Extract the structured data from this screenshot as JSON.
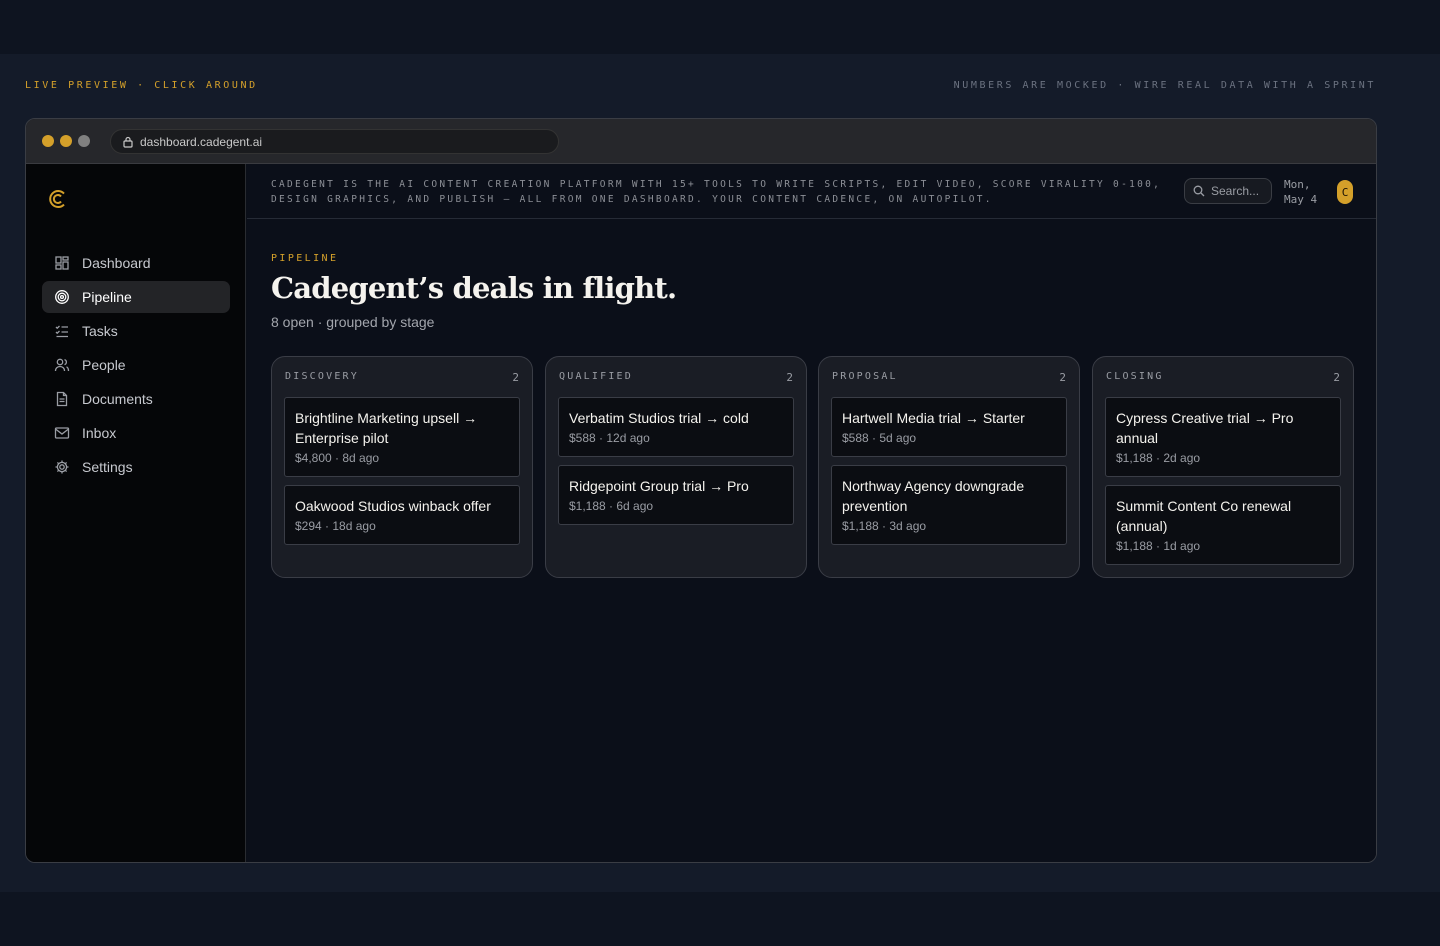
{
  "page": {
    "preview_label": "LIVE PREVIEW · CLICK AROUND",
    "mock_note": "NUMBERS ARE MOCKED · WIRE REAL DATA WITH A SPRINT"
  },
  "browser": {
    "url": "dashboard.cadegent.ai"
  },
  "sidebar": {
    "items": [
      {
        "label": "Dashboard",
        "icon": "dashboard-icon"
      },
      {
        "label": "Pipeline",
        "icon": "target-icon",
        "active": true
      },
      {
        "label": "Tasks",
        "icon": "checklist-icon"
      },
      {
        "label": "People",
        "icon": "users-icon"
      },
      {
        "label": "Documents",
        "icon": "document-icon"
      },
      {
        "label": "Inbox",
        "icon": "mail-icon"
      },
      {
        "label": "Settings",
        "icon": "gear-icon"
      }
    ]
  },
  "topbar": {
    "tagline": "CADEGENT IS THE AI CONTENT CREATION PLATFORM WITH 15+ TOOLS TO WRITE SCRIPTS, EDIT VIDEO, SCORE VIRALITY 0-100, DESIGN GRAPHICS, AND PUBLISH — ALL FROM ONE DASHBOARD. YOUR CONTENT CADENCE, ON AUTOPILOT.",
    "search_placeholder": "Search...",
    "date": "Mon, May 4",
    "avatar_initial": "C"
  },
  "header": {
    "eyebrow": "PIPELINE",
    "title": "Cadegent’s deals in flight.",
    "subtitle": "8 open · grouped by stage"
  },
  "columns": [
    {
      "name": "DISCOVERY",
      "count": "2",
      "cards": [
        {
          "title": "Brightline Marketing upsell → Enterprise pilot",
          "meta": "$4,800 · 8d ago"
        },
        {
          "title": "Oakwood Studios winback offer",
          "meta": "$294 · 18d ago"
        }
      ]
    },
    {
      "name": "QUALIFIED",
      "count": "2",
      "cards": [
        {
          "title": "Verbatim Studios trial → cold",
          "meta": "$588 · 12d ago"
        },
        {
          "title": "Ridgepoint Group trial → Pro",
          "meta": "$1,188 · 6d ago"
        }
      ]
    },
    {
      "name": "PROPOSAL",
      "count": "2",
      "cards": [
        {
          "title": "Hartwell Media trial → Starter",
          "meta": "$588 · 5d ago"
        },
        {
          "title": "Northway Agency downgrade prevention",
          "meta": "$1,188 · 3d ago"
        }
      ]
    },
    {
      "name": "CLOSING",
      "count": "2",
      "cards": [
        {
          "title": "Cypress Creative trial → Pro annual",
          "meta": "$1,188 · 2d ago"
        },
        {
          "title": "Summit Content Co renewal (annual)",
          "meta": "$1,188 · 1d ago"
        }
      ]
    }
  ],
  "colors": {
    "accent": "#d4a02a",
    "background": "#0b0f19",
    "sidebar": "#050608"
  }
}
